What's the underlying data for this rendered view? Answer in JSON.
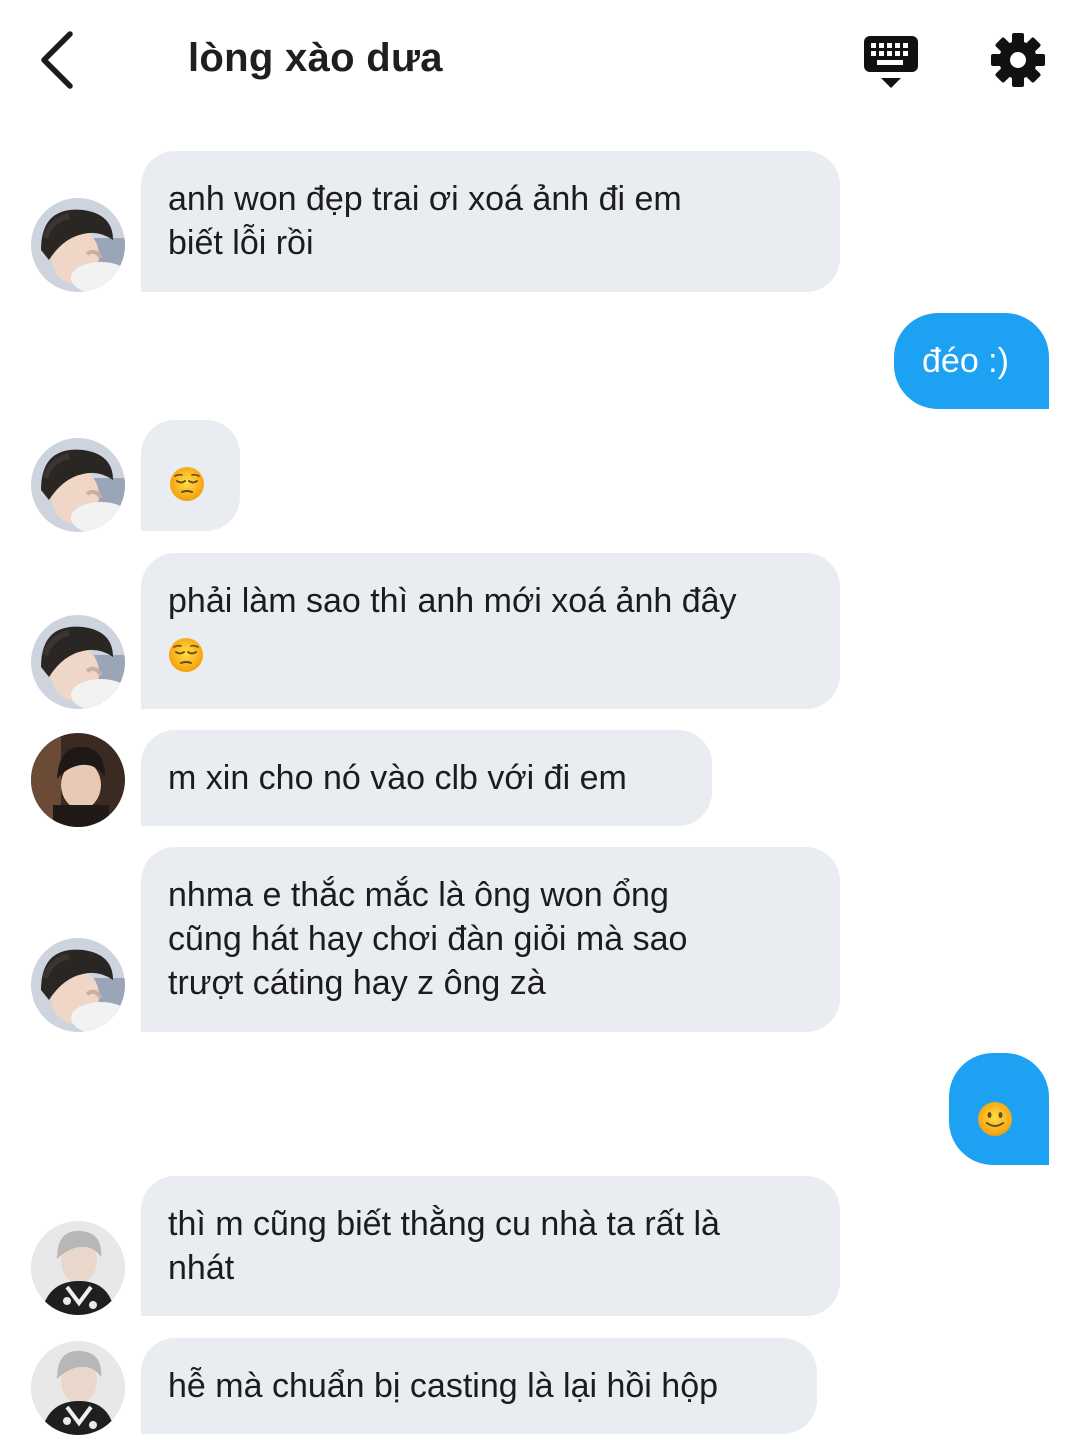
{
  "header": {
    "title": "lòng xào dưa",
    "back_icon": "chevron-left-icon",
    "keyboard_icon": "keyboard-hide-icon",
    "settings_icon": "gear-icon"
  },
  "colors": {
    "incoming_bubble": "#e9ecf0",
    "outgoing_bubble": "#1da1f2",
    "outgoing_text": "#ffffff"
  },
  "messages": [
    {
      "side": "in",
      "text": "anh won đẹp trai ơi xoá ảnh đi em\nbiết lỗi rồi",
      "avatar": "avatar-a"
    },
    {
      "side": "out",
      "text": "đéo :)"
    },
    {
      "side": "in",
      "emoji": "pensive-face-emoji",
      "avatar": "avatar-a"
    },
    {
      "side": "in",
      "text": "phải làm sao thì anh mới xoá ảnh đây",
      "emoji": "pensive-face-emoji",
      "avatar": "avatar-a"
    },
    {
      "side": "in",
      "text": "m xin cho nó vào clb với đi em",
      "avatar": "avatar-b"
    },
    {
      "side": "in",
      "text": "nhma e thắc mắc là ông won ổng\ncũng hát hay chơi đàn giỏi mà sao\ntrượt cáting hay z ông zà",
      "avatar": "avatar-a"
    },
    {
      "side": "out",
      "emoji": "slightly-smiling-face-emoji"
    },
    {
      "side": "in",
      "text": "thì m cũng biết thằng cu nhà ta rất là\nnhát",
      "avatar": "avatar-c"
    },
    {
      "side": "in",
      "text": "hễ mà chuẩn bị casting là lại hồi hộp",
      "avatar": "avatar-c"
    }
  ]
}
